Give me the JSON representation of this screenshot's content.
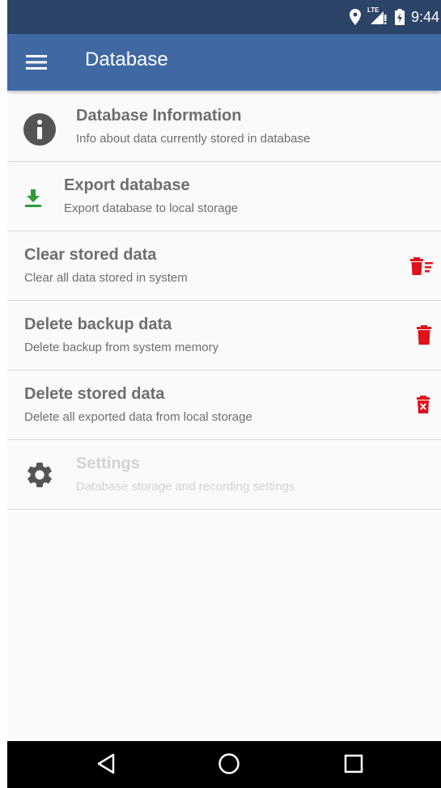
{
  "status_bar": {
    "time": "9:44",
    "network_label": "LTE",
    "icons": [
      "location-icon",
      "lte-signal-icon",
      "battery-charging-icon"
    ]
  },
  "app_bar": {
    "title": "Database",
    "menu_icon": "hamburger-menu-icon"
  },
  "items": [
    {
      "title": "Database Information",
      "subtitle": "Info about data currently stored in database",
      "icon": "info-icon",
      "icon_color": "#545454"
    },
    {
      "title": "Export database",
      "subtitle": "Export database to local storage",
      "icon": "download-icon",
      "icon_color": "#2e9c3b"
    },
    {
      "title": "Clear stored data",
      "subtitle": "Clear all data stored in system",
      "icon": "trash-clear-icon",
      "icon_color": "#e0121b"
    },
    {
      "title": "Delete backup data",
      "subtitle": "Delete backup from system memory",
      "icon": "trash-icon",
      "icon_color": "#e0121b"
    },
    {
      "title": "Delete stored data",
      "subtitle": "Delete all exported data from local storage",
      "icon": "trash-x-icon",
      "icon_color": "#e0121b"
    },
    {
      "title": "Settings",
      "subtitle": "Database storage and recording settings",
      "icon": "gear-icon",
      "icon_color": "#545454",
      "disabled": true
    }
  ],
  "nav_bar": {
    "buttons": [
      "back-icon",
      "home-icon",
      "recents-icon"
    ]
  },
  "colors": {
    "status_bar": "#2d4469",
    "app_bar": "#4069a4",
    "text": "#6e6e6e",
    "disabled_text": "#d2d2d2",
    "danger": "#e0121b",
    "export_green": "#2e9c3b"
  }
}
